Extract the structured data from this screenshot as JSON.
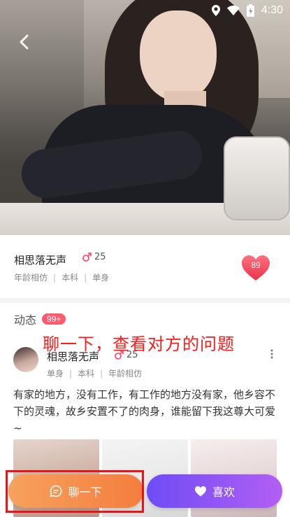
{
  "status_bar": {
    "time": "4:30",
    "icons": [
      "location-icon",
      "wifi-icon",
      "battery-icon"
    ]
  },
  "header": {
    "back_icon": "chevron-left-icon"
  },
  "profile": {
    "name": "相思落无声",
    "gender_icon": "male-icon",
    "age": "25",
    "tags": [
      "年龄相仿",
      "本科",
      "单身"
    ],
    "match_score": "89",
    "match_icon": "heart-icon"
  },
  "feed": {
    "title": "动态",
    "count_badge": "99+",
    "annotation": "聊一下，查看对方的问题",
    "post": {
      "author": "相思落无声",
      "age": "25",
      "tags": [
        "单身",
        "本科",
        "年龄相仿"
      ],
      "text": "有家的地方，没有工作，有工作的地方没有家，他乡容不下的灵魂，故乡安置不了的肉身，谁能留下我这尊大可爱~",
      "photo_count": 3
    }
  },
  "actions": {
    "chat_label": "聊一下",
    "chat_icon": "chat-bubble-icon",
    "like_label": "喜欢",
    "like_icon": "heart-icon"
  },
  "colors": {
    "chat_gradient": [
      "#f6a25d",
      "#f47d3f"
    ],
    "like_gradient": [
      "#6f4cf5",
      "#b25ff3"
    ],
    "badge": "#ff5a6e",
    "annotation": "#ff1a1a",
    "gender": "#ff4f73"
  }
}
